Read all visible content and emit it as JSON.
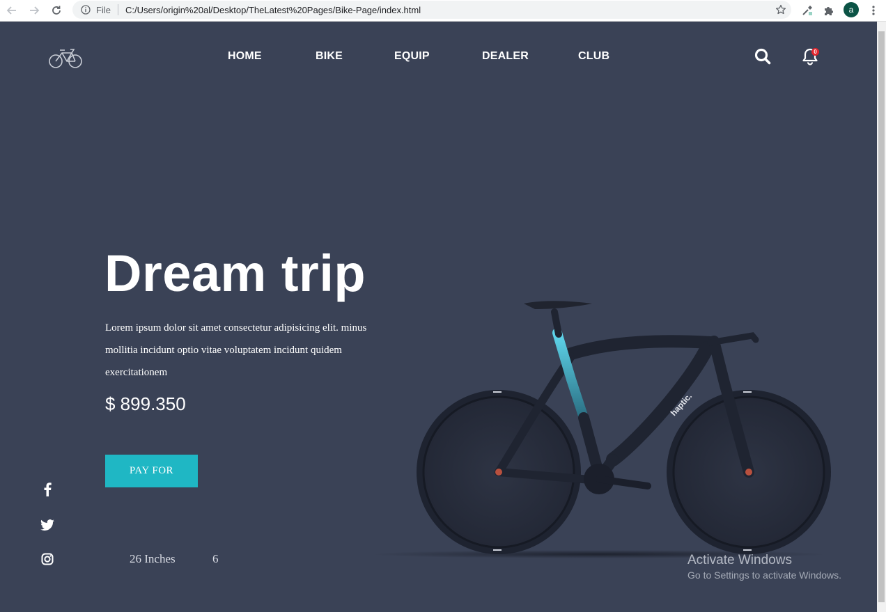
{
  "browser": {
    "file_label": "File",
    "url": "C:/Users/origin%20al/Desktop/TheLatest%20Pages/Bike-Page/index.html",
    "profile_initial": "a"
  },
  "header": {
    "logo_icon": "bicycle-logo-icon",
    "menu": [
      {
        "label": "HOME"
      },
      {
        "label": "BIKE"
      },
      {
        "label": "EQUIP"
      },
      {
        "label": "DEALER"
      },
      {
        "label": "CLUB"
      }
    ],
    "notification_count": "0"
  },
  "hero": {
    "title": "Dream trip",
    "description": "Lorem ipsum dolor sit amet consectetur adipisicing elit. minus mollitia incidunt optio vitae voluptatem incidunt quidem exercitationem",
    "price": "$ 899.350",
    "pay_button": "PAY FOR",
    "bike_brand": "haptic."
  },
  "specs": {
    "size": "26 Inches",
    "count": "6"
  },
  "social": [
    "facebook-icon",
    "twitter-icon",
    "instagram-icon"
  ],
  "watermark": {
    "title": "Activate Windows",
    "subtitle": "Go to Settings to activate Windows."
  },
  "colors": {
    "background": "#3a4256",
    "accent": "#1fb7c4",
    "badge": "#e3262e"
  }
}
